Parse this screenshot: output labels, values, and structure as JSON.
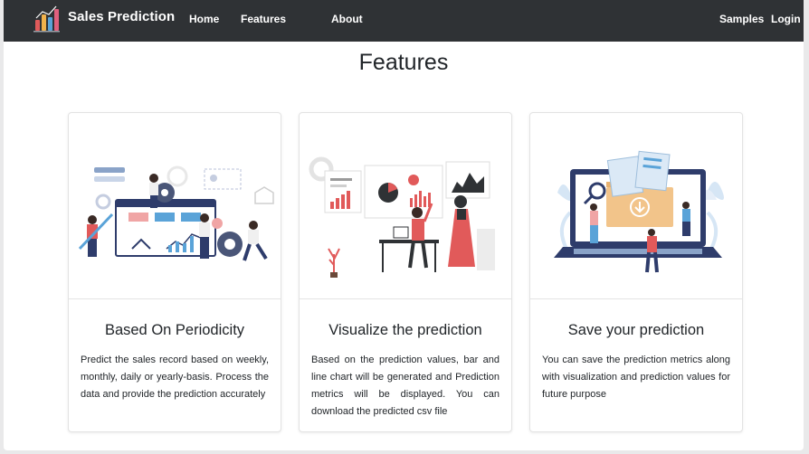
{
  "navbar": {
    "brand": "Sales Prediction",
    "links": [
      "Home",
      "Features",
      "About"
    ],
    "right_links": [
      "Samples",
      "Login"
    ]
  },
  "page_title": "Features",
  "cards": [
    {
      "title": "Based On Periodicity",
      "text": "Predict the sales record based on weekly, monthly, daily or yearly-basis. Process the data and provide the prediction accurately",
      "illustration": "analytics-dashboard-illustration"
    },
    {
      "title": "Visualize the prediction",
      "text": "Based on the prediction values, bar and line chart will be generated and Prediction metrics will be displayed. You can download the predicted csv file",
      "illustration": "presentation-charts-illustration"
    },
    {
      "title": "Save your prediction",
      "text": "You can save the prediction metrics along with visualization and prediction values for future purpose",
      "illustration": "laptop-download-illustration"
    }
  ],
  "colors": {
    "navbar": "#2f3235",
    "accent_blue": "#5aa3d8",
    "accent_red": "#e15a5a",
    "navy": "#2e3c6b"
  }
}
